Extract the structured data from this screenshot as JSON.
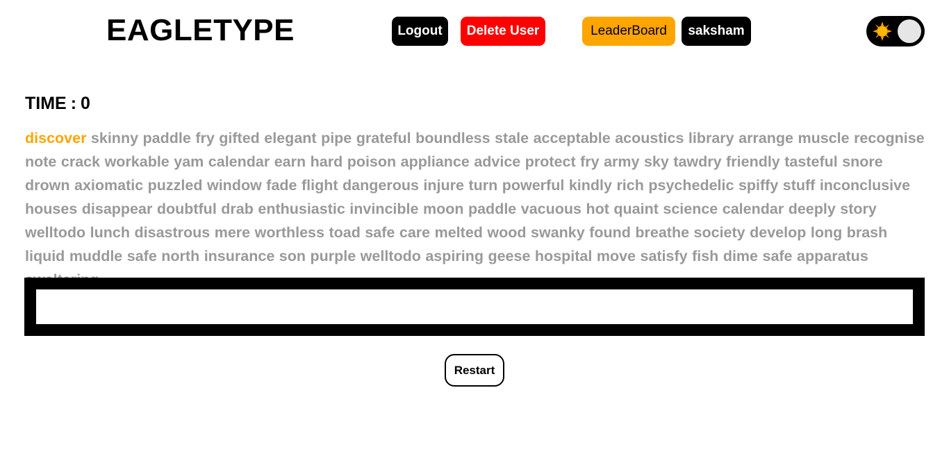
{
  "header": {
    "logo": "EAGLETYPE",
    "logout_label": "Logout",
    "delete_user_label": "Delete User",
    "leaderboard_label": "LeaderBoard",
    "username": "saksham",
    "theme_toggle_icon": "sun-icon"
  },
  "colors": {
    "accent": "#ffa500",
    "danger": "#ff0000",
    "pending_words": "#999999"
  },
  "timer": {
    "label": "TIME",
    "separator": ":",
    "value": "0"
  },
  "words": {
    "current_index": 0,
    "list": [
      "discover",
      "skinny",
      "paddle",
      "fry",
      "gifted",
      "elegant",
      "pipe",
      "grateful",
      "boundless",
      "stale",
      "acceptable",
      "acoustics",
      "library",
      "arrange",
      "muscle",
      "recognise",
      "note",
      "crack",
      "workable",
      "yam",
      "calendar",
      "earn",
      "hard",
      "poison",
      "appliance",
      "advice",
      "protect",
      "fry",
      "army",
      "sky",
      "tawdry",
      "friendly",
      "tasteful",
      "snore",
      "drown",
      "axiomatic",
      "puzzled",
      "window",
      "fade",
      "flight",
      "dangerous",
      "injure",
      "turn",
      "powerful",
      "kindly",
      "rich",
      "psychedelic",
      "spiffy",
      "stuff",
      "inconclusive",
      "houses",
      "disappear",
      "doubtful",
      "drab",
      "enthusiastic",
      "invincible",
      "moon",
      "paddle",
      "vacuous",
      "hot",
      "quaint",
      "science",
      "calendar",
      "deeply",
      "story",
      "welltodo",
      "lunch",
      "disastrous",
      "mere",
      "worthless",
      "toad",
      "safe",
      "care",
      "melted",
      "wood",
      "swanky",
      "found",
      "breathe",
      "society",
      "develop",
      "long",
      "brash",
      "liquid",
      "muddle",
      "safe",
      "north",
      "insurance",
      "son",
      "purple",
      "welltodo",
      "aspiring",
      "geese",
      "hospital",
      "move",
      "satisfy",
      "fish",
      "dime",
      "safe",
      "apparatus",
      "sweltering"
    ]
  },
  "typing_input": {
    "value": "",
    "placeholder": ""
  },
  "restart_label": "Restart"
}
